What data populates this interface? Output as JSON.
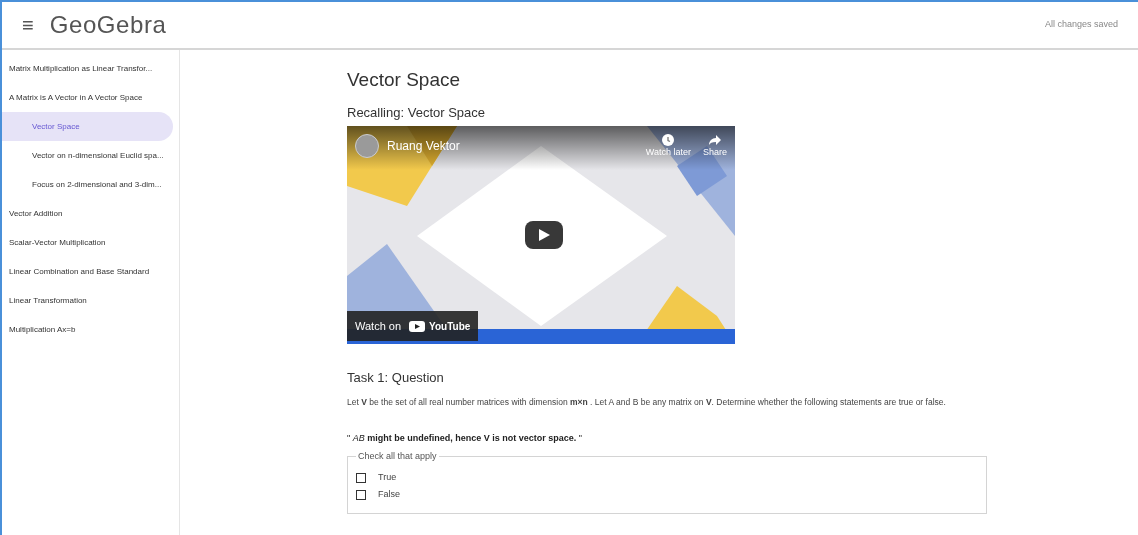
{
  "header": {
    "menu_icon": "≡",
    "logo": "GeoGebra",
    "status": "All changes saved"
  },
  "sidebar": {
    "items": [
      {
        "label": "Matrix Multiplication as Linear Transfor...",
        "selected": false
      },
      {
        "label": "A Matrix is A Vector in A Vector Space",
        "selected": false,
        "children": [
          {
            "label": "Vector Space",
            "selected": true
          },
          {
            "label": "Vector on n-dimensional Euclid spa...",
            "selected": false
          },
          {
            "label": "Focus on 2-dimensional and 3-dim...",
            "selected": false
          }
        ]
      },
      {
        "label": "Vector Addition",
        "selected": false
      },
      {
        "label": "Scalar-Vector Multiplication",
        "selected": false
      },
      {
        "label": "Linear Combination and Base Standard",
        "selected": false
      },
      {
        "label": "Linear Transformation",
        "selected": false
      },
      {
        "label": "Multiplication Ax=b",
        "selected": false
      }
    ]
  },
  "content": {
    "title": "Vector Space",
    "subtitle": "Recalling: Vector Space",
    "video": {
      "kind": "picture",
      "channel": "Ruang Vektor",
      "watch_later": "Watch later",
      "share": "Share",
      "watch_on": "Watch on",
      "platform": "YouTube"
    },
    "task": {
      "title": "Task 1: Question",
      "question": "Let **V** be the set of all real number matrices with dimension **m×n** . Let A and B be any matrix on **V**. Determine whether the following statements are true or false.",
      "statement": "\" *AB* **might be undefined, hence V is not vector space.** \"",
      "legend": "Check all that apply",
      "options": [
        {
          "label": "True",
          "checked": false
        },
        {
          "label": "False",
          "checked": false
        }
      ]
    }
  }
}
